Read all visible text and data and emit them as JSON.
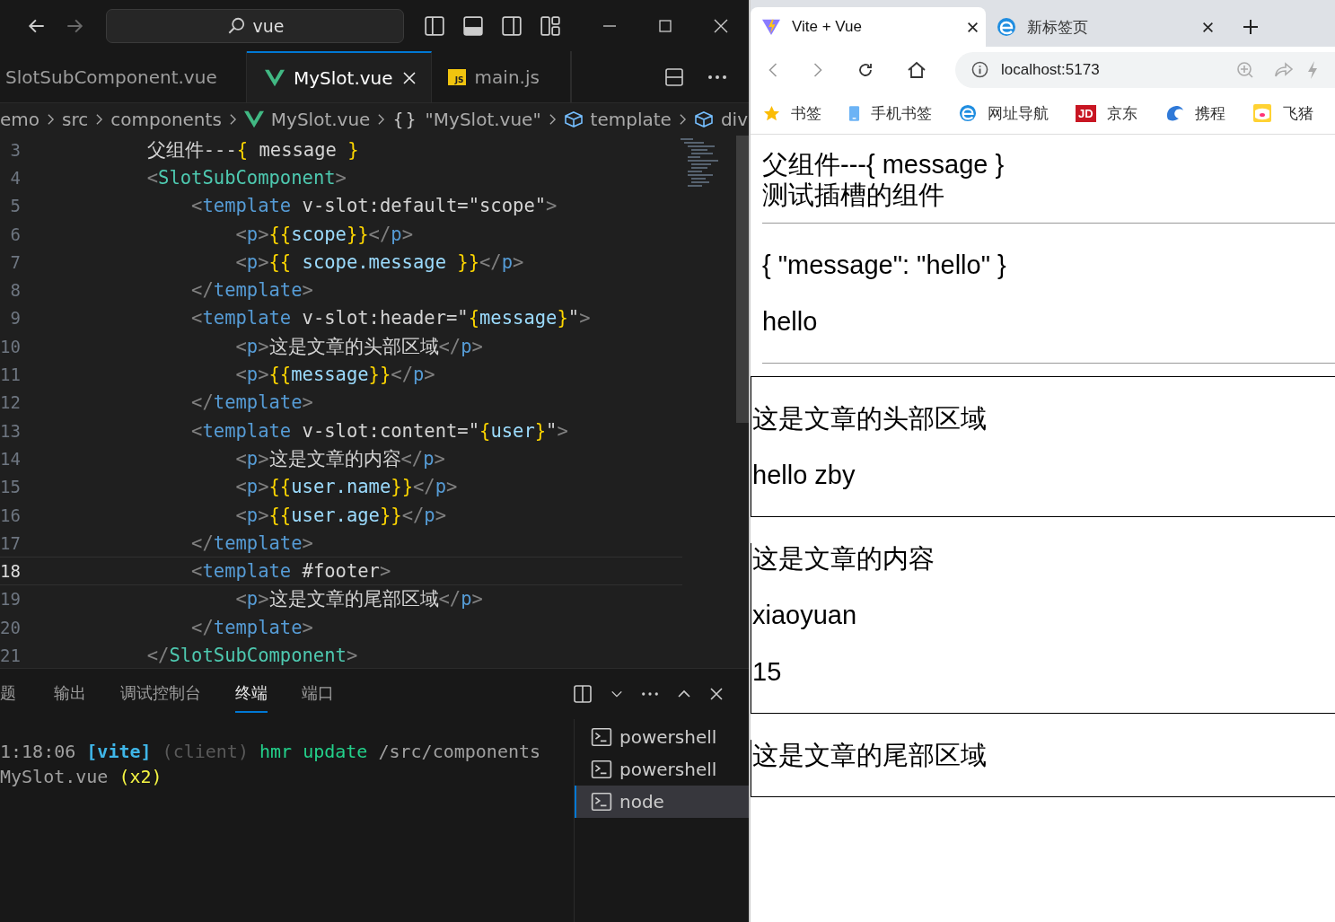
{
  "editor": {
    "search": {
      "value": "vue"
    },
    "tabs": [
      {
        "label": "SlotSubComponent.vue",
        "kind": "none",
        "selected": false
      },
      {
        "label": "MySlot.vue",
        "kind": "vue",
        "selected": true
      },
      {
        "label": "main.js",
        "kind": "js",
        "badge": "JS",
        "selected": false
      }
    ],
    "breadcrumbs": [
      {
        "label": "emo",
        "kind": "none"
      },
      {
        "label": "src",
        "kind": "none"
      },
      {
        "label": "components",
        "kind": "none"
      },
      {
        "label": "MySlot.vue",
        "kind": "vue"
      },
      {
        "label": "\"MySlot.vue\"",
        "kind": "braces",
        "icon_text": "{}"
      },
      {
        "label": "template",
        "kind": "cube"
      },
      {
        "label": "div",
        "kind": "cube"
      }
    ],
    "lines": [
      {
        "number": "3",
        "current": false,
        "tokens": [
          {
            "kind": "text",
            "text": "        父组件---"
          },
          {
            "kind": "brace",
            "text": "{"
          },
          {
            "kind": "text",
            "text": " message "
          },
          {
            "kind": "brace",
            "text": "}"
          }
        ]
      },
      {
        "number": "4",
        "current": false,
        "tokens": [
          {
            "kind": "punct",
            "text": "        <"
          },
          {
            "kind": "component",
            "text": "SlotSubComponent"
          },
          {
            "kind": "punct",
            "text": ">"
          }
        ]
      },
      {
        "number": "5",
        "current": false,
        "tokens": [
          {
            "kind": "punct",
            "text": "            <"
          },
          {
            "kind": "tag",
            "text": "template"
          },
          {
            "kind": "attr",
            "text": " v-slot:default=\"scope\""
          },
          {
            "kind": "punct",
            "text": ">"
          }
        ]
      },
      {
        "number": "6",
        "current": false,
        "tokens": [
          {
            "kind": "punct",
            "text": "                <"
          },
          {
            "kind": "tag",
            "text": "p"
          },
          {
            "kind": "punct",
            "text": ">"
          },
          {
            "kind": "brace",
            "text": "{{"
          },
          {
            "kind": "expr",
            "text": "scope"
          },
          {
            "kind": "brace",
            "text": "}}"
          },
          {
            "kind": "punct",
            "text": "</"
          },
          {
            "kind": "tag",
            "text": "p"
          },
          {
            "kind": "punct",
            "text": ">"
          }
        ]
      },
      {
        "number": "7",
        "current": false,
        "tokens": [
          {
            "kind": "punct",
            "text": "                <"
          },
          {
            "kind": "tag",
            "text": "p"
          },
          {
            "kind": "punct",
            "text": ">"
          },
          {
            "kind": "brace",
            "text": "{{"
          },
          {
            "kind": "expr",
            "text": " scope.message "
          },
          {
            "kind": "brace",
            "text": "}}"
          },
          {
            "kind": "punct",
            "text": "</"
          },
          {
            "kind": "tag",
            "text": "p"
          },
          {
            "kind": "punct",
            "text": ">"
          }
        ]
      },
      {
        "number": "8",
        "current": false,
        "tokens": [
          {
            "kind": "punct",
            "text": "            </"
          },
          {
            "kind": "tag",
            "text": "template"
          },
          {
            "kind": "punct",
            "text": ">"
          }
        ]
      },
      {
        "number": "9",
        "current": false,
        "tokens": [
          {
            "kind": "punct",
            "text": "            <"
          },
          {
            "kind": "tag",
            "text": "template"
          },
          {
            "kind": "attr",
            "text": " v-slot:header=\""
          },
          {
            "kind": "brace",
            "text": "{"
          },
          {
            "kind": "expr",
            "text": "message"
          },
          {
            "kind": "brace",
            "text": "}"
          },
          {
            "kind": "attr",
            "text": "\""
          },
          {
            "kind": "punct",
            "text": ">"
          }
        ]
      },
      {
        "number": "10",
        "current": false,
        "tokens": [
          {
            "kind": "punct",
            "text": "                <"
          },
          {
            "kind": "tag",
            "text": "p"
          },
          {
            "kind": "punct",
            "text": ">"
          },
          {
            "kind": "text",
            "text": "这是文章的头部区域"
          },
          {
            "kind": "punct",
            "text": "</"
          },
          {
            "kind": "tag",
            "text": "p"
          },
          {
            "kind": "punct",
            "text": ">"
          }
        ]
      },
      {
        "number": "11",
        "current": false,
        "tokens": [
          {
            "kind": "punct",
            "text": "                <"
          },
          {
            "kind": "tag",
            "text": "p"
          },
          {
            "kind": "punct",
            "text": ">"
          },
          {
            "kind": "brace",
            "text": "{{"
          },
          {
            "kind": "expr",
            "text": "message"
          },
          {
            "kind": "brace",
            "text": "}}"
          },
          {
            "kind": "punct",
            "text": "</"
          },
          {
            "kind": "tag",
            "text": "p"
          },
          {
            "kind": "punct",
            "text": ">"
          }
        ]
      },
      {
        "number": "12",
        "current": false,
        "tokens": [
          {
            "kind": "punct",
            "text": "            </"
          },
          {
            "kind": "tag",
            "text": "template"
          },
          {
            "kind": "punct",
            "text": ">"
          }
        ]
      },
      {
        "number": "13",
        "current": false,
        "tokens": [
          {
            "kind": "punct",
            "text": "            <"
          },
          {
            "kind": "tag",
            "text": "template"
          },
          {
            "kind": "attr",
            "text": " v-slot:content=\""
          },
          {
            "kind": "brace",
            "text": "{"
          },
          {
            "kind": "expr",
            "text": "user"
          },
          {
            "kind": "brace",
            "text": "}"
          },
          {
            "kind": "attr",
            "text": "\""
          },
          {
            "kind": "punct",
            "text": ">"
          }
        ]
      },
      {
        "number": "14",
        "current": false,
        "tokens": [
          {
            "kind": "punct",
            "text": "                <"
          },
          {
            "kind": "tag",
            "text": "p"
          },
          {
            "kind": "punct",
            "text": ">"
          },
          {
            "kind": "text",
            "text": "这是文章的内容"
          },
          {
            "kind": "punct",
            "text": "</"
          },
          {
            "kind": "tag",
            "text": "p"
          },
          {
            "kind": "punct",
            "text": ">"
          }
        ]
      },
      {
        "number": "15",
        "current": false,
        "tokens": [
          {
            "kind": "punct",
            "text": "                <"
          },
          {
            "kind": "tag",
            "text": "p"
          },
          {
            "kind": "punct",
            "text": ">"
          },
          {
            "kind": "brace",
            "text": "{{"
          },
          {
            "kind": "expr",
            "text": "user.name"
          },
          {
            "kind": "brace",
            "text": "}}"
          },
          {
            "kind": "punct",
            "text": "</"
          },
          {
            "kind": "tag",
            "text": "p"
          },
          {
            "kind": "punct",
            "text": ">"
          }
        ]
      },
      {
        "number": "16",
        "current": false,
        "tokens": [
          {
            "kind": "punct",
            "text": "                <"
          },
          {
            "kind": "tag",
            "text": "p"
          },
          {
            "kind": "punct",
            "text": ">"
          },
          {
            "kind": "brace",
            "text": "{{"
          },
          {
            "kind": "expr",
            "text": "user.age"
          },
          {
            "kind": "brace",
            "text": "}}"
          },
          {
            "kind": "punct",
            "text": "</"
          },
          {
            "kind": "tag",
            "text": "p"
          },
          {
            "kind": "punct",
            "text": ">"
          }
        ]
      },
      {
        "number": "17",
        "current": false,
        "tokens": [
          {
            "kind": "punct",
            "text": "            </"
          },
          {
            "kind": "tag",
            "text": "template"
          },
          {
            "kind": "punct",
            "text": ">"
          }
        ]
      },
      {
        "number": "18",
        "current": true,
        "tokens": [
          {
            "kind": "punct",
            "text": "            <"
          },
          {
            "kind": "tag",
            "text": "template"
          },
          {
            "kind": "attr",
            "text": " #footer"
          },
          {
            "kind": "punct",
            "text": ">"
          }
        ]
      },
      {
        "number": "19",
        "current": false,
        "tokens": [
          {
            "kind": "punct",
            "text": "                <"
          },
          {
            "kind": "tag",
            "text": "p"
          },
          {
            "kind": "punct",
            "text": ">"
          },
          {
            "kind": "text",
            "text": "这是文章的尾部区域"
          },
          {
            "kind": "punct",
            "text": "</"
          },
          {
            "kind": "tag",
            "text": "p"
          },
          {
            "kind": "punct",
            "text": ">"
          }
        ]
      },
      {
        "number": "20",
        "current": false,
        "tokens": [
          {
            "kind": "punct",
            "text": "            </"
          },
          {
            "kind": "tag",
            "text": "template"
          },
          {
            "kind": "punct",
            "text": ">"
          }
        ]
      },
      {
        "number": "21",
        "current": false,
        "tokens": [
          {
            "kind": "punct",
            "text": "        </"
          },
          {
            "kind": "component",
            "text": "SlotSubComponent"
          },
          {
            "kind": "punct",
            "text": ">"
          }
        ]
      }
    ],
    "panel_tabs": [
      {
        "label": "题",
        "selected": false
      },
      {
        "label": "输出",
        "selected": false
      },
      {
        "label": "调试控制台",
        "selected": false
      },
      {
        "label": "终端",
        "selected": true
      },
      {
        "label": "端口",
        "selected": false
      }
    ],
    "terminal_lines": [
      [
        {
          "kind": "dim",
          "text": "1:18:06 "
        },
        {
          "kind": "cyan",
          "text": "[vite]"
        },
        {
          "kind": "faint",
          "text": " (client)"
        },
        {
          "kind": "green",
          "text": " hmr update"
        },
        {
          "kind": "dim",
          "text": " /src/components"
        }
      ],
      [
        {
          "kind": "dim",
          "text": "MySlot.vue"
        },
        {
          "kind": "yellow",
          "text": " (x2)"
        }
      ]
    ],
    "terminals": [
      {
        "label": "powershell",
        "selected": false
      },
      {
        "label": "powershell",
        "selected": false
      },
      {
        "label": "node",
        "selected": true
      }
    ]
  },
  "browser": {
    "tabs": [
      {
        "label": "Vite + Vue",
        "kind": "vite",
        "selected": true
      },
      {
        "label": "新标签页",
        "kind": "edge",
        "selected": false
      }
    ],
    "address": "localhost:5173",
    "bookmarks": [
      {
        "label": "书签",
        "kind": "star"
      },
      {
        "label": "手机书签",
        "kind": "phone"
      },
      {
        "label": "网址导航",
        "kind": "edge"
      },
      {
        "label": "京东",
        "kind": "letter",
        "badge": "JD"
      },
      {
        "label": "携程",
        "kind": "dolphin"
      },
      {
        "label": "飞猪",
        "kind": "pig"
      }
    ],
    "page": {
      "intro": [
        "父组件---{ message }",
        "测试插槽的组件"
      ],
      "scope_block": [
        "{ \"message\": \"hello\" }",
        "hello"
      ],
      "boxes": [
        [
          "这是文章的头部区域",
          "hello zby"
        ],
        [
          "这是文章的内容",
          "xiaoyuan",
          "15"
        ],
        [
          "这是文章的尾部区域"
        ]
      ]
    }
  }
}
